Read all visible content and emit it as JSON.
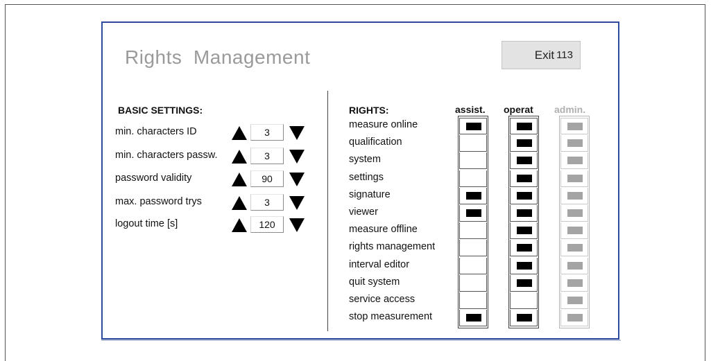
{
  "title": "Rights  Management",
  "exit": {
    "label": "Exit",
    "code": "113"
  },
  "basic": {
    "heading": "BASIC SETTINGS:",
    "items": [
      {
        "label": "min. characters ID",
        "value": "3"
      },
      {
        "label": "min. characters passw.",
        "value": "3"
      },
      {
        "label": "password validity",
        "value": "90"
      },
      {
        "label": "max. password trys",
        "value": "3"
      },
      {
        "label": "logout time [s]",
        "value": "120"
      }
    ]
  },
  "rights": {
    "heading": "RIGHTS:",
    "columns": [
      {
        "label": "assist.",
        "color": "#111111"
      },
      {
        "label": "operat",
        "color": "#111111"
      },
      {
        "label": "admin.",
        "color": "#b0b0b0"
      }
    ],
    "items": [
      {
        "label": "measure online",
        "assist": true,
        "operat": true,
        "admin": true
      },
      {
        "label": "qualification",
        "assist": false,
        "operat": true,
        "admin": true
      },
      {
        "label": "system",
        "assist": false,
        "operat": true,
        "admin": true
      },
      {
        "label": "settings",
        "assist": false,
        "operat": true,
        "admin": true
      },
      {
        "label": "signature",
        "assist": true,
        "operat": true,
        "admin": true
      },
      {
        "label": "viewer",
        "assist": true,
        "operat": true,
        "admin": true
      },
      {
        "label": "measure offline",
        "assist": false,
        "operat": true,
        "admin": true
      },
      {
        "label": "rights management",
        "assist": false,
        "operat": true,
        "admin": true
      },
      {
        "label": "interval editor",
        "assist": false,
        "operat": true,
        "admin": true
      },
      {
        "label": "quit system",
        "assist": false,
        "operat": true,
        "admin": true
      },
      {
        "label": "service access",
        "assist": false,
        "operat": false,
        "admin": true
      },
      {
        "label": "stop measurement",
        "assist": true,
        "operat": true,
        "admin": true
      }
    ]
  },
  "colors": {
    "panel_border": "#2e4a9e",
    "title": "#9a9a9a",
    "enabled": "#000000",
    "admin_enabled": "#a4a4a4"
  }
}
